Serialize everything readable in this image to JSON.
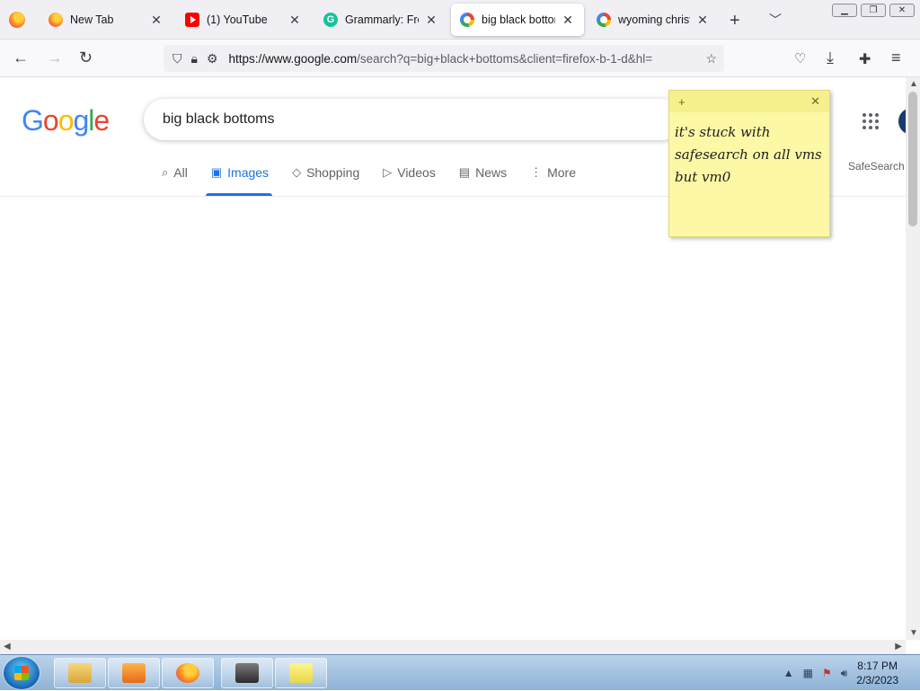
{
  "browser": {
    "tabs": [
      {
        "label": "New Tab",
        "favicon": "firefox-icon",
        "active": false
      },
      {
        "label": "(1) YouTube",
        "favicon": "youtube-icon",
        "active": false
      },
      {
        "label": "Grammarly: Free O",
        "favicon": "grammarly-icon",
        "active": false
      },
      {
        "label": "big black bottoms",
        "favicon": "google-icon",
        "active": true
      },
      {
        "label": "wyoming christia",
        "favicon": "google-icon",
        "active": false
      }
    ],
    "url": "https://www.google.com/search?q=big+black+bottoms&client=firefox-b-1-d&hl=",
    "url_host": "https://www.google.com",
    "url_path": "/search?q=big+black+bottoms&client=firefox-b-1-d&hl="
  },
  "google": {
    "logo_letters": [
      "G",
      "o",
      "o",
      "g",
      "l",
      "e"
    ],
    "query": "big black bottoms",
    "safesearch_label": "SafeSearch",
    "nav_tabs": [
      {
        "label": "All",
        "icon": "search-icon",
        "active": false
      },
      {
        "label": "Images",
        "icon": "image-icon",
        "active": true
      },
      {
        "label": "Shopping",
        "icon": "tag-icon",
        "active": false
      },
      {
        "label": "Videos",
        "icon": "play-icon",
        "active": false
      },
      {
        "label": "News",
        "icon": "newspaper-icon",
        "active": false
      },
      {
        "label": "More",
        "icon": "more-vertical-icon",
        "active": false
      }
    ],
    "results": []
  },
  "sticky_note": {
    "text_lines": [
      "it's stuck with",
      "safesearch on all vms",
      "but vm0"
    ]
  },
  "taskbar": {
    "time": "8:17 PM",
    "date": "2/3/2023"
  },
  "colors": {
    "google_blue": "#1a73e8",
    "in_stock_green": "#188038",
    "sticky_yellow": "#fcf8a6"
  }
}
